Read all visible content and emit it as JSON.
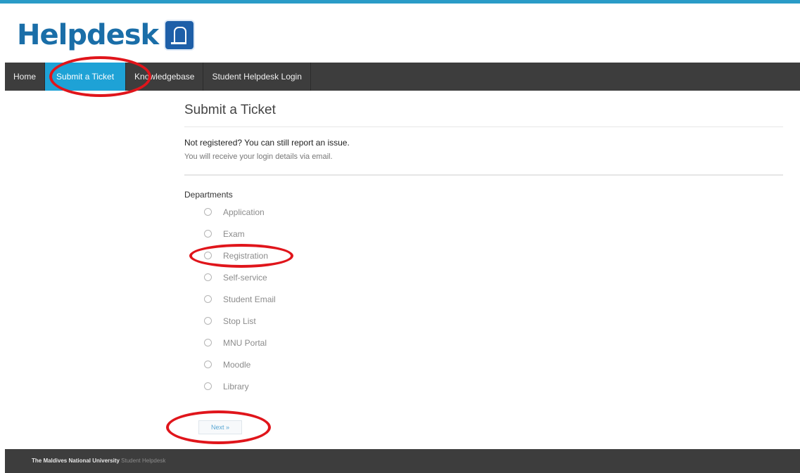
{
  "brand": {
    "logo_text": "Helpdesk"
  },
  "nav": {
    "items": [
      {
        "label": "Home",
        "active": false
      },
      {
        "label": "Submit a Ticket",
        "active": true
      },
      {
        "label": "Knowledgebase",
        "active": false
      },
      {
        "label": "Student Helpdesk Login",
        "active": false
      }
    ]
  },
  "main": {
    "title": "Submit a Ticket",
    "notice_title": "Not registered? You can still report an issue.",
    "notice_sub": "You will receive your login details via email.",
    "departments_label": "Departments",
    "departments": [
      "Application",
      "Exam",
      "Registration",
      "Self-service",
      "Student Email",
      "Stop List",
      "MNU Portal",
      "Moodle",
      "Library"
    ],
    "next_label": "Next »"
  },
  "footer": {
    "org": "The Maldives National University",
    "suffix": "Student Helpdesk"
  },
  "colors": {
    "accent": "#1ea2d6",
    "nav_bg": "#3d3d3d",
    "annotation": "#e0151b"
  }
}
